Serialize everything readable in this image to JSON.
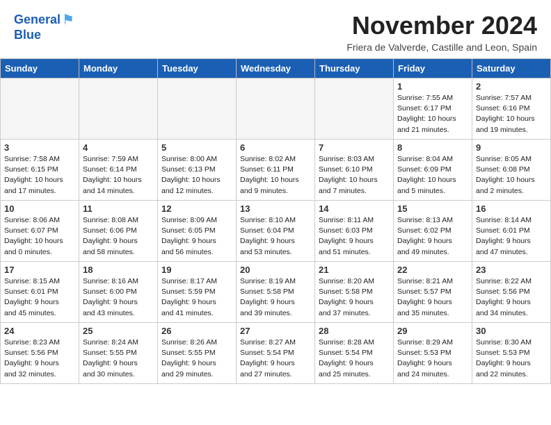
{
  "header": {
    "logo_line1": "General",
    "logo_line2": "Blue",
    "month_title": "November 2024",
    "subtitle": "Friera de Valverde, Castille and Leon, Spain"
  },
  "weekdays": [
    "Sunday",
    "Monday",
    "Tuesday",
    "Wednesday",
    "Thursday",
    "Friday",
    "Saturday"
  ],
  "weeks": [
    [
      {
        "day": "",
        "info": ""
      },
      {
        "day": "",
        "info": ""
      },
      {
        "day": "",
        "info": ""
      },
      {
        "day": "",
        "info": ""
      },
      {
        "day": "",
        "info": ""
      },
      {
        "day": "1",
        "info": "Sunrise: 7:55 AM\nSunset: 6:17 PM\nDaylight: 10 hours\nand 21 minutes."
      },
      {
        "day": "2",
        "info": "Sunrise: 7:57 AM\nSunset: 6:16 PM\nDaylight: 10 hours\nand 19 minutes."
      }
    ],
    [
      {
        "day": "3",
        "info": "Sunrise: 7:58 AM\nSunset: 6:15 PM\nDaylight: 10 hours\nand 17 minutes."
      },
      {
        "day": "4",
        "info": "Sunrise: 7:59 AM\nSunset: 6:14 PM\nDaylight: 10 hours\nand 14 minutes."
      },
      {
        "day": "5",
        "info": "Sunrise: 8:00 AM\nSunset: 6:13 PM\nDaylight: 10 hours\nand 12 minutes."
      },
      {
        "day": "6",
        "info": "Sunrise: 8:02 AM\nSunset: 6:11 PM\nDaylight: 10 hours\nand 9 minutes."
      },
      {
        "day": "7",
        "info": "Sunrise: 8:03 AM\nSunset: 6:10 PM\nDaylight: 10 hours\nand 7 minutes."
      },
      {
        "day": "8",
        "info": "Sunrise: 8:04 AM\nSunset: 6:09 PM\nDaylight: 10 hours\nand 5 minutes."
      },
      {
        "day": "9",
        "info": "Sunrise: 8:05 AM\nSunset: 6:08 PM\nDaylight: 10 hours\nand 2 minutes."
      }
    ],
    [
      {
        "day": "10",
        "info": "Sunrise: 8:06 AM\nSunset: 6:07 PM\nDaylight: 10 hours\nand 0 minutes."
      },
      {
        "day": "11",
        "info": "Sunrise: 8:08 AM\nSunset: 6:06 PM\nDaylight: 9 hours\nand 58 minutes."
      },
      {
        "day": "12",
        "info": "Sunrise: 8:09 AM\nSunset: 6:05 PM\nDaylight: 9 hours\nand 56 minutes."
      },
      {
        "day": "13",
        "info": "Sunrise: 8:10 AM\nSunset: 6:04 PM\nDaylight: 9 hours\nand 53 minutes."
      },
      {
        "day": "14",
        "info": "Sunrise: 8:11 AM\nSunset: 6:03 PM\nDaylight: 9 hours\nand 51 minutes."
      },
      {
        "day": "15",
        "info": "Sunrise: 8:13 AM\nSunset: 6:02 PM\nDaylight: 9 hours\nand 49 minutes."
      },
      {
        "day": "16",
        "info": "Sunrise: 8:14 AM\nSunset: 6:01 PM\nDaylight: 9 hours\nand 47 minutes."
      }
    ],
    [
      {
        "day": "17",
        "info": "Sunrise: 8:15 AM\nSunset: 6:01 PM\nDaylight: 9 hours\nand 45 minutes."
      },
      {
        "day": "18",
        "info": "Sunrise: 8:16 AM\nSunset: 6:00 PM\nDaylight: 9 hours\nand 43 minutes."
      },
      {
        "day": "19",
        "info": "Sunrise: 8:17 AM\nSunset: 5:59 PM\nDaylight: 9 hours\nand 41 minutes."
      },
      {
        "day": "20",
        "info": "Sunrise: 8:19 AM\nSunset: 5:58 PM\nDaylight: 9 hours\nand 39 minutes."
      },
      {
        "day": "21",
        "info": "Sunrise: 8:20 AM\nSunset: 5:58 PM\nDaylight: 9 hours\nand 37 minutes."
      },
      {
        "day": "22",
        "info": "Sunrise: 8:21 AM\nSunset: 5:57 PM\nDaylight: 9 hours\nand 35 minutes."
      },
      {
        "day": "23",
        "info": "Sunrise: 8:22 AM\nSunset: 5:56 PM\nDaylight: 9 hours\nand 34 minutes."
      }
    ],
    [
      {
        "day": "24",
        "info": "Sunrise: 8:23 AM\nSunset: 5:56 PM\nDaylight: 9 hours\nand 32 minutes."
      },
      {
        "day": "25",
        "info": "Sunrise: 8:24 AM\nSunset: 5:55 PM\nDaylight: 9 hours\nand 30 minutes."
      },
      {
        "day": "26",
        "info": "Sunrise: 8:26 AM\nSunset: 5:55 PM\nDaylight: 9 hours\nand 29 minutes."
      },
      {
        "day": "27",
        "info": "Sunrise: 8:27 AM\nSunset: 5:54 PM\nDaylight: 9 hours\nand 27 minutes."
      },
      {
        "day": "28",
        "info": "Sunrise: 8:28 AM\nSunset: 5:54 PM\nDaylight: 9 hours\nand 25 minutes."
      },
      {
        "day": "29",
        "info": "Sunrise: 8:29 AM\nSunset: 5:53 PM\nDaylight: 9 hours\nand 24 minutes."
      },
      {
        "day": "30",
        "info": "Sunrise: 8:30 AM\nSunset: 5:53 PM\nDaylight: 9 hours\nand 22 minutes."
      }
    ]
  ]
}
